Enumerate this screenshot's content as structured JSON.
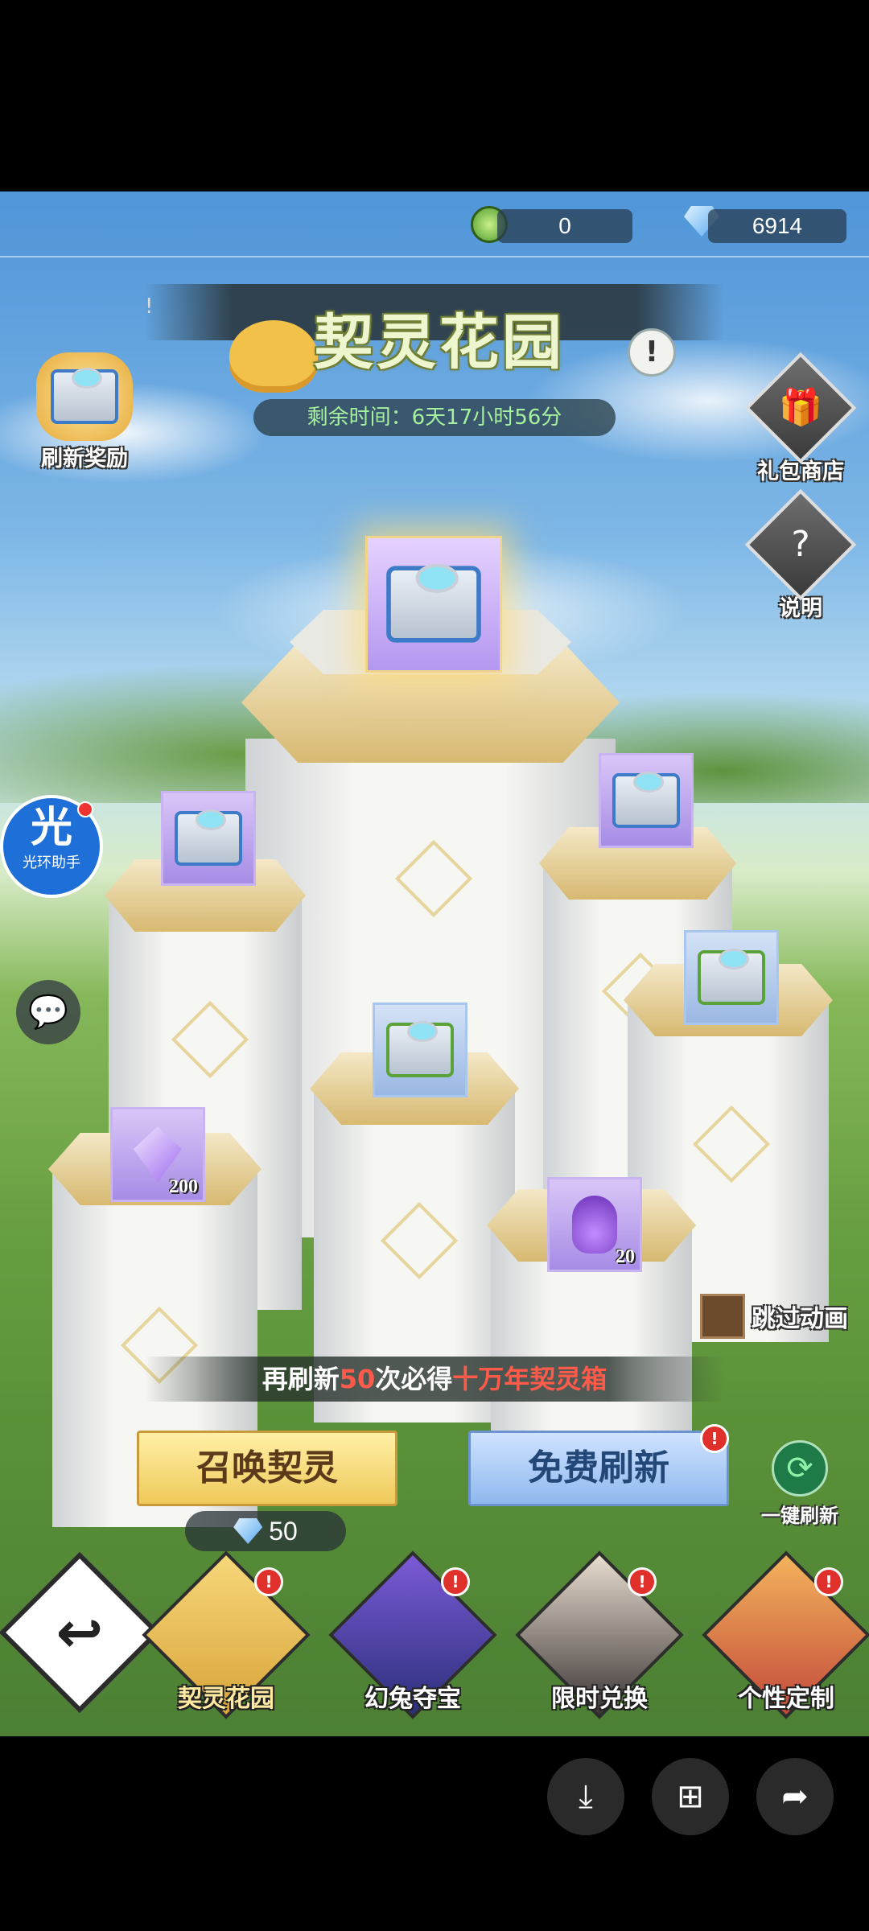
{
  "header": {
    "clover_currency": "0",
    "diamond_currency": "6914",
    "corner_mark": "!",
    "title": "契灵花园",
    "timer": "剩余时间：6天17小时56分",
    "info_icon_char": "!"
  },
  "side_left": {
    "refresh_reward_label": "刷新奖励",
    "helper_big": "光",
    "helper_small": "光环助手",
    "chat_icon_char": "💬"
  },
  "side_right": {
    "gift_shop_label": "礼包商店",
    "help_label": "说明",
    "gift_icon_char": "🎁",
    "help_icon_char": "?"
  },
  "items": [
    {
      "name": "top-chest",
      "type": "chest",
      "count": ""
    },
    {
      "name": "left-chest",
      "type": "chest",
      "count": ""
    },
    {
      "name": "right-chest",
      "type": "chest",
      "count": ""
    },
    {
      "name": "center-chest",
      "type": "chest-green",
      "count": ""
    },
    {
      "name": "far-right-chest",
      "type": "chest-green",
      "count": ""
    },
    {
      "name": "crystal",
      "type": "crystal",
      "count": "200"
    },
    {
      "name": "potion",
      "type": "potion",
      "count": "20"
    }
  ],
  "skip": {
    "label": "跳过动画"
  },
  "promo": {
    "prefix": "再刷新",
    "count": "50",
    "middle": "次必得",
    "reward": "十万年契灵箱"
  },
  "actions": {
    "summon_label": "召唤契灵",
    "refresh_label": "免费刷新",
    "refresh_badge": "!",
    "cost_value": "50",
    "one_refresh_label": "一键刷新",
    "one_refresh_icon": "⟳"
  },
  "tabs": [
    {
      "label": "契灵花园",
      "badge": "!"
    },
    {
      "label": "幻兔夺宝",
      "badge": "!"
    },
    {
      "label": "限时兑换",
      "badge": "!"
    },
    {
      "label": "个性定制",
      "badge": "!"
    }
  ],
  "back_icon_char": "↩",
  "system_buttons": {
    "download": "⤓",
    "apps": "⊞",
    "share": "➦"
  },
  "colors": {
    "promo_highlight": "#ff5a4a",
    "timer_text": "#a6f0a0",
    "badge": "#e0302c"
  }
}
